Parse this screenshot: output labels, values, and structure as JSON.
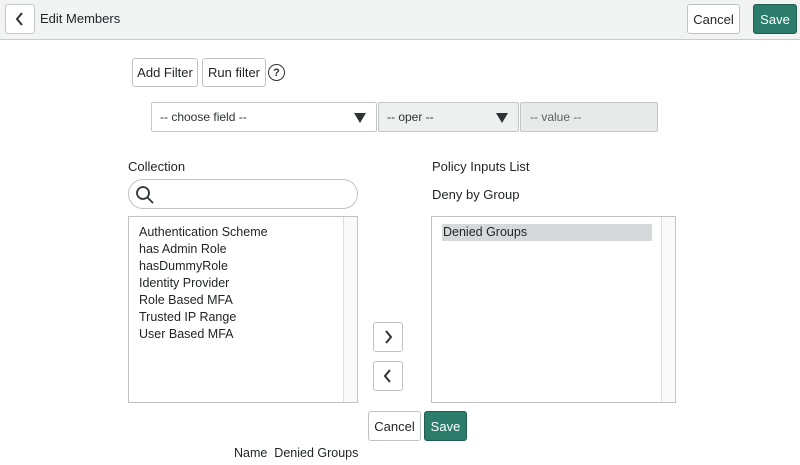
{
  "header": {
    "back_icon": "chevron-left-icon",
    "title": "Edit Members",
    "cancel_label": "Cancel",
    "save_label": "Save"
  },
  "filter": {
    "add_filter_label": "Add Filter",
    "run_filter_label": "Run filter",
    "help_icon": "question-circle-icon",
    "field_select": "-- choose field --",
    "oper_select": "-- oper --",
    "value_placeholder": "-- value --"
  },
  "collection": {
    "heading": "Collection",
    "search_value": "",
    "items": [
      "Authentication Scheme",
      "has Admin Role",
      "hasDummyRole",
      "Identity Provider",
      "Role Based MFA",
      "Trusted IP Range",
      "User Based MFA"
    ]
  },
  "policy": {
    "heading": "Policy Inputs List",
    "subheading": "Deny by Group",
    "items": [
      "Denied Groups"
    ],
    "selected_index": 0
  },
  "move": {
    "add_icon": "chevron-right-icon",
    "remove_icon": "chevron-left-icon"
  },
  "footer": {
    "cancel_label": "Cancel",
    "save_label": "Save",
    "name_key": "Name",
    "name_value": "Denied Groups"
  },
  "colors": {
    "primary": "#2b7c6b",
    "topbar": "#f2f3f3"
  }
}
